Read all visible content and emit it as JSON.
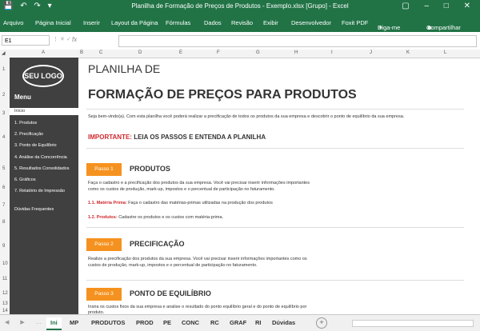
{
  "title_bar": {
    "window_title": "Planilha de Formação de Preços de Produtos - Exemplo.xlsx  [Grupo] - Excel",
    "quick_access_icons": [
      "save-icon",
      "undo-icon",
      "redo-icon",
      "customize-icon"
    ],
    "window_controls": [
      "ribbon-options-icon",
      "minimize-icon",
      "maximize-icon",
      "close-icon"
    ]
  },
  "ribbon": {
    "tabs": [
      "Arquivo",
      "Página Inicial",
      "Inserir",
      "Layout da Página",
      "Fórmulas",
      "Dados",
      "Revisão",
      "Exibir",
      "Desenvolvedor",
      "Foxit PDF"
    ],
    "tell_me": "Diga-me",
    "share": "Compartilhar"
  },
  "formula_bar": {
    "name_box": "E1",
    "fx": "fx",
    "formula": ""
  },
  "columns": [
    "A",
    "B",
    "C",
    "D",
    "E",
    "F",
    "G",
    "H",
    "I",
    "J",
    "K",
    "L"
  ],
  "rows": [
    "1",
    "2",
    "3",
    "4",
    "5",
    "6",
    "7",
    "8",
    "9",
    "10",
    "11",
    "12",
    "13",
    "14"
  ],
  "sidebar": {
    "logo": "SEU LOGO",
    "menu_title": "Menu",
    "items": [
      "Início",
      "1. Produtos",
      "2. Precificação",
      "3. Ponto de Equilíbrio",
      "4. Análise da Concorrência",
      "5. Resultados Consolidados",
      "6. Gráficos",
      "7. Relatório de Impressão",
      "Dúvidas Frequentes"
    ],
    "active_item": "Início"
  },
  "content": {
    "title_line1": "PLANILHA DE",
    "title_line2": "FORMAÇÃO DE PREÇOS PARA PRODUTOS",
    "welcome": "Seja bem-vindo(a). Com esta planilha você poderá realizar a precificação de todos os produtos da sua empresa e descobrir o ponto de equilíbrio da sua empresa.",
    "important_label": "IMPORTANTE:",
    "important_text": " LEIA OS PASSOS E ENTENDA A PLANILHA",
    "steps": [
      {
        "badge": "Passo 1",
        "heading": "PRODUTOS",
        "desc_line1": "Faça o cadastro e a precificação dos produtos da sua empresa. Você vai precisar inserir informações importantes",
        "desc_line2": "como os custos de produção, mark-up, impostos e o percentual de participação no faturamento.",
        "sub1_label": "1.1. Matéria Prima:",
        "sub1_text": " Faça o cadastro das matérias-primas utilizadas na produção dos produtos",
        "sub2_label": "1.2. Produtos:",
        "sub2_text": " Cadastre os produtos e os custos com matéria-prima."
      },
      {
        "badge": "Passo 2",
        "heading": "PRECIFICAÇÃO",
        "desc_line1": "Realize a precificação dos produtos da sua empresa. Você vai precisar inserir informações importantes como os",
        "desc_line2": "custos de produção, mark-up, impostos e o percentual de participação no faturamento."
      },
      {
        "badge": "Passo 3",
        "heading": "PONTO DE EQUILÍBRIO",
        "desc_line1": "Insira os custos fixos da sua empresa e analise o resultado do ponto equilíbrio geral e do ponto de equilíbrio por",
        "desc_line2": "produto."
      }
    ]
  },
  "sheet_tabs": {
    "tabs": [
      "Ini",
      "MP",
      "PRODUTOS",
      "PROD",
      "PE",
      "CONC",
      "RC",
      "GRAF",
      "RI",
      "Dúvidas"
    ],
    "active": "Ini"
  },
  "colors": {
    "excel_green": "#217346",
    "sidebar_bg": "#404040",
    "step_orange": "#f5921f",
    "important_red": "#d1282e"
  }
}
